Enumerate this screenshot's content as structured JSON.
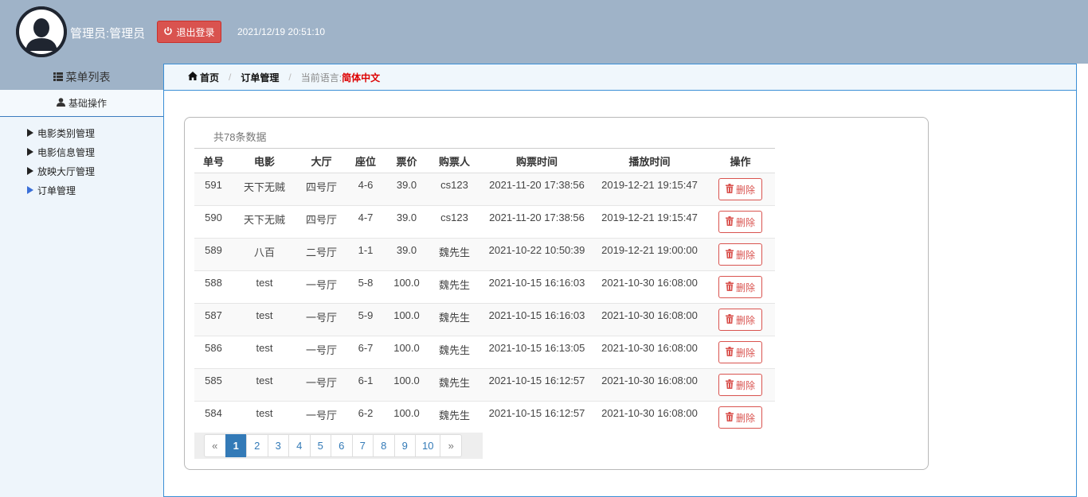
{
  "header": {
    "admin_name": "管理员:管理员",
    "logout_label": "退出登录",
    "datetime": "2021/12/19 20:51:10"
  },
  "sidebar": {
    "menu_title": "菜单列表",
    "section_title": "基础操作",
    "items": [
      {
        "label": "电影类别管理",
        "active": false
      },
      {
        "label": "电影信息管理",
        "active": false
      },
      {
        "label": "放映大厅管理",
        "active": false
      },
      {
        "label": "订单管理",
        "active": true
      }
    ]
  },
  "breadcrumb": {
    "home": "首页",
    "current": "订单管理",
    "lang_label": "当前语言:",
    "lang_value": "简体中文"
  },
  "table": {
    "total_text": "共78条数据",
    "columns": [
      "单号",
      "电影",
      "大厅",
      "座位",
      "票价",
      "购票人",
      "购票时间",
      "播放时间",
      "操作"
    ],
    "delete_label": "删除",
    "rows": [
      [
        "591",
        "天下无贼",
        "四号厅",
        "4-6",
        "39.0",
        "cs123",
        "2021-11-20 17:38:56",
        "2019-12-21 19:15:47"
      ],
      [
        "590",
        "天下无贼",
        "四号厅",
        "4-7",
        "39.0",
        "cs123",
        "2021-11-20 17:38:56",
        "2019-12-21 19:15:47"
      ],
      [
        "589",
        "八百",
        "二号厅",
        "1-1",
        "39.0",
        "魏先生",
        "2021-10-22 10:50:39",
        "2019-12-21 19:00:00"
      ],
      [
        "588",
        "test",
        "一号厅",
        "5-8",
        "100.0",
        "魏先生",
        "2021-10-15 16:16:03",
        "2021-10-30 16:08:00"
      ],
      [
        "587",
        "test",
        "一号厅",
        "5-9",
        "100.0",
        "魏先生",
        "2021-10-15 16:16:03",
        "2021-10-30 16:08:00"
      ],
      [
        "586",
        "test",
        "一号厅",
        "6-7",
        "100.0",
        "魏先生",
        "2021-10-15 16:13:05",
        "2021-10-30 16:08:00"
      ],
      [
        "585",
        "test",
        "一号厅",
        "6-1",
        "100.0",
        "魏先生",
        "2021-10-15 16:12:57",
        "2021-10-30 16:08:00"
      ],
      [
        "584",
        "test",
        "一号厅",
        "6-2",
        "100.0",
        "魏先生",
        "2021-10-15 16:12:57",
        "2021-10-30 16:08:00"
      ]
    ]
  },
  "pagination": {
    "prev": "«",
    "next": "»",
    "pages": [
      "1",
      "2",
      "3",
      "4",
      "5",
      "6",
      "7",
      "8",
      "9",
      "10"
    ],
    "current": "1"
  },
  "colors": {
    "header_bg": "#9fb3c8",
    "danger": "#d9534f",
    "primary": "#337ab7",
    "sidebar_bg": "#eef5fb"
  },
  "icons": {
    "avatar": "user-avatar-icon",
    "logout": "power-icon",
    "menu": "list-icon",
    "section": "user-icon",
    "home": "home-icon",
    "delete": "trash-icon",
    "nav_arrow": "triangle-right-icon"
  }
}
